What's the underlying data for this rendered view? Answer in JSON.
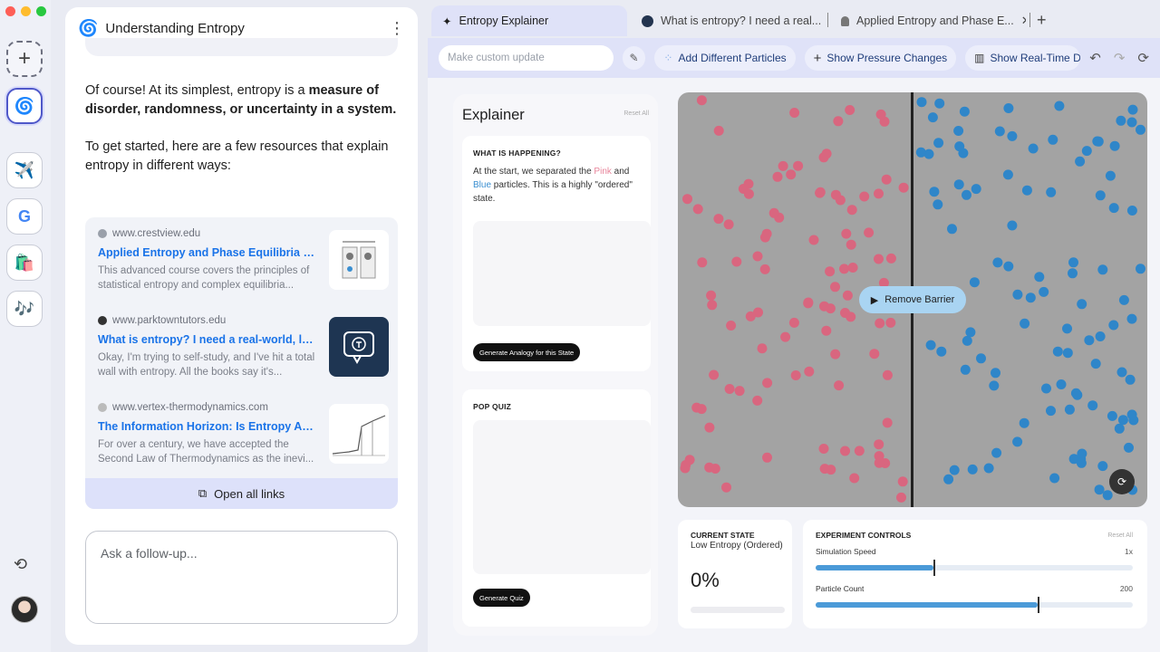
{
  "chat": {
    "title": "Understanding Entropy",
    "intro_plain": "Of course! At its simplest, entropy is a ",
    "intro_bold": "measure of disorder, randomness, or uncertainty in a system.",
    "para2": "To get started, here are a few resources that explain entropy in different ways:",
    "sources": [
      {
        "domain": "www.crestview.edu",
        "title": "Applied Entropy and Phase Equilibria | Crest...",
        "desc": "This advanced course covers the principles of statistical entropy and complex equilibria..."
      },
      {
        "domain": "www.parktowntutors.edu",
        "title": "What is entropy? I need a real-world, layman's",
        "desc": "Okay, I'm trying to self-study, and I've hit a total wall with entropy. All the books say it's..."
      },
      {
        "domain": "www.vertex-thermodynamics.com",
        "title": "The Information Horizon: Is Entropy Actuall...",
        "desc": "For over a century, we have accepted the Second Law of Thermodynamics as the inevi..."
      }
    ],
    "open_all_links": "Open all links",
    "followup_placeholder": "Ask a follow-up..."
  },
  "tabs": [
    {
      "label": "Entropy Explainer"
    },
    {
      "label": "What is entropy? I need a real..."
    },
    {
      "label": "Applied Entropy and Phase E..."
    }
  ],
  "toolbar": {
    "custom_placeholder": "Make custom update",
    "chips": [
      "Add Different Particles",
      "Show Pressure Changes",
      "Show Real-Time D"
    ]
  },
  "explainer": {
    "title": "Explainer",
    "reset": "Reset All",
    "happening_label": "WHAT IS HAPPENING?",
    "happening_pre": "At the start, we separated the ",
    "pink_word": "Pink",
    "happening_mid": " and ",
    "blue_word": "Blue",
    "happening_post": " particles. This is a highly \"ordered\" state.",
    "analogy_button": "Generate Analogy for this State",
    "quiz_label": "POP QUIZ",
    "quiz_button": "Generate Quiz"
  },
  "simulation": {
    "remove_barrier": "Remove Barrier",
    "pink_color": "#d9667f",
    "blue_color": "#2f86c9"
  },
  "state": {
    "label": "CURRENT STATE",
    "sub": "Low Entropy (Ordered)",
    "value": "0%"
  },
  "controls": {
    "title": "EXPERIMENT CONTROLS",
    "reset": "Reset All",
    "sliders": [
      {
        "label": "Simulation Speed",
        "value": "1x",
        "fraction": 0.37
      },
      {
        "label": "Particle Count",
        "value": "200",
        "fraction": 0.7
      }
    ]
  }
}
